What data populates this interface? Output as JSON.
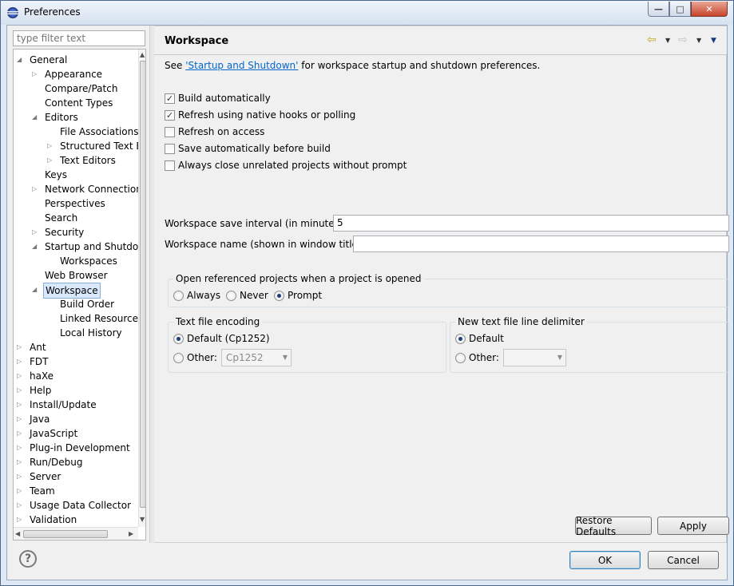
{
  "window": {
    "title": "Preferences",
    "min_glyph": "—",
    "max_glyph": "□",
    "close_glyph": "✕"
  },
  "filter": {
    "placeholder": "type filter text"
  },
  "tree": {
    "items": [
      {
        "label": "General",
        "level": 0,
        "twisty": "open"
      },
      {
        "label": "Appearance",
        "level": 1,
        "twisty": "closed"
      },
      {
        "label": "Compare/Patch",
        "level": 1,
        "twisty": "none"
      },
      {
        "label": "Content Types",
        "level": 1,
        "twisty": "none"
      },
      {
        "label": "Editors",
        "level": 1,
        "twisty": "open"
      },
      {
        "label": "File Associations",
        "level": 2,
        "twisty": "none"
      },
      {
        "label": "Structured Text E",
        "level": 2,
        "twisty": "closed"
      },
      {
        "label": "Text Editors",
        "level": 2,
        "twisty": "closed"
      },
      {
        "label": "Keys",
        "level": 1,
        "twisty": "none"
      },
      {
        "label": "Network Connection",
        "level": 1,
        "twisty": "closed"
      },
      {
        "label": "Perspectives",
        "level": 1,
        "twisty": "none"
      },
      {
        "label": "Search",
        "level": 1,
        "twisty": "none"
      },
      {
        "label": "Security",
        "level": 1,
        "twisty": "closed"
      },
      {
        "label": "Startup and Shutdov",
        "level": 1,
        "twisty": "open"
      },
      {
        "label": "Workspaces",
        "level": 2,
        "twisty": "none"
      },
      {
        "label": "Web Browser",
        "level": 1,
        "twisty": "none"
      },
      {
        "label": "Workspace",
        "level": 1,
        "twisty": "open",
        "selected": true
      },
      {
        "label": "Build Order",
        "level": 2,
        "twisty": "none"
      },
      {
        "label": "Linked Resource",
        "level": 2,
        "twisty": "none"
      },
      {
        "label": "Local History",
        "level": 2,
        "twisty": "none"
      },
      {
        "label": "Ant",
        "level": 0,
        "twisty": "closed"
      },
      {
        "label": "FDT",
        "level": 0,
        "twisty": "closed"
      },
      {
        "label": "haXe",
        "level": 0,
        "twisty": "closed"
      },
      {
        "label": "Help",
        "level": 0,
        "twisty": "closed"
      },
      {
        "label": "Install/Update",
        "level": 0,
        "twisty": "closed"
      },
      {
        "label": "Java",
        "level": 0,
        "twisty": "closed"
      },
      {
        "label": "JavaScript",
        "level": 0,
        "twisty": "closed"
      },
      {
        "label": "Plug-in Development",
        "level": 0,
        "twisty": "closed"
      },
      {
        "label": "Run/Debug",
        "level": 0,
        "twisty": "closed"
      },
      {
        "label": "Server",
        "level": 0,
        "twisty": "closed"
      },
      {
        "label": "Team",
        "level": 0,
        "twisty": "closed"
      },
      {
        "label": "Usage Data Collector",
        "level": 0,
        "twisty": "closed"
      },
      {
        "label": "Validation",
        "level": 0,
        "twisty": "closed"
      }
    ]
  },
  "page": {
    "title": "Workspace",
    "see_prefix": "See ",
    "see_link": "'Startup and Shutdown'",
    "see_suffix": " for workspace startup and shutdown preferences.",
    "checkboxes": [
      {
        "label": "Build automatically",
        "checked": true
      },
      {
        "label": "Refresh using native hooks or polling",
        "checked": true
      },
      {
        "label": "Refresh on access",
        "checked": false
      },
      {
        "label": "Save automatically before build",
        "checked": false
      },
      {
        "label": "Always close unrelated projects without prompt",
        "checked": false
      }
    ],
    "save_interval_label": "Workspace save interval (in minutes):",
    "save_interval_value": "5",
    "name_label": "Workspace name (shown in window title):",
    "name_value": "",
    "open_ref": {
      "title": "Open referenced projects when a project is opened",
      "options": [
        {
          "label": "Always",
          "selected": false
        },
        {
          "label": "Never",
          "selected": false
        },
        {
          "label": "Prompt",
          "selected": true
        }
      ]
    },
    "encoding": {
      "title": "Text file encoding",
      "default_label": "Default (Cp1252)",
      "default_selected": true,
      "other_label": "Other:",
      "other_value": "Cp1252"
    },
    "delimiter": {
      "title": "New text file line delimiter",
      "default_label": "Default",
      "default_selected": true,
      "other_label": "Other:",
      "other_value": ""
    },
    "restore_defaults": "Restore Defaults",
    "apply": "Apply"
  },
  "footer": {
    "help_glyph": "?",
    "ok": "OK",
    "cancel": "Cancel"
  },
  "icons": {
    "back": "back-arrow-icon",
    "forward": "forward-arrow-icon",
    "menu": "view-menu-icon"
  }
}
